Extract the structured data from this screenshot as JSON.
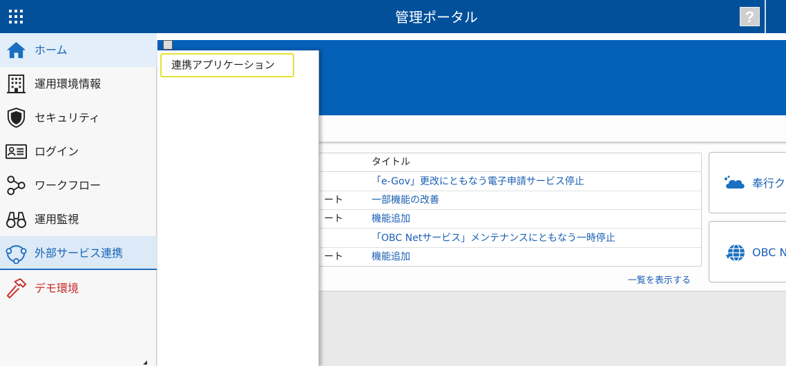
{
  "header": {
    "title": "管理ポータル",
    "apps_icon": "apps-grid-icon",
    "help_label": "?"
  },
  "sidebar": {
    "items": [
      {
        "label": "ホーム",
        "icon": "home-icon"
      },
      {
        "label": "運用環境情報",
        "icon": "building-icon"
      },
      {
        "label": "セキュリティ",
        "icon": "shield-icon"
      },
      {
        "label": "ログイン",
        "icon": "id-card-icon"
      },
      {
        "label": "ワークフロー",
        "icon": "workflow-icon"
      },
      {
        "label": "運用監視",
        "icon": "binoculars-icon"
      },
      {
        "label": "外部サービス連携",
        "icon": "link-circle-icon"
      },
      {
        "label": "デモ環境",
        "icon": "hammer-icon"
      }
    ]
  },
  "flyout": {
    "items": [
      {
        "label": "連携アプリケーション"
      }
    ]
  },
  "news": {
    "column_title": "タイトル",
    "rows": [
      {
        "category": "",
        "title": "「e-Gov」更改にともなう電子申請サービス停止"
      },
      {
        "category": "ート",
        "title": "一部機能の改善"
      },
      {
        "category": "ート",
        "title": "機能追加"
      },
      {
        "category": "",
        "title": "「OBC Netサービス」メンテナンスにともなう一時停止"
      },
      {
        "category": "ート",
        "title": "機能追加"
      }
    ],
    "show_all": "一覧を表示する"
  },
  "cards": [
    {
      "label": "奉行ク",
      "icon": "cloud-icon"
    },
    {
      "label": "OBC N",
      "icon": "globe-icon"
    }
  ],
  "colors": {
    "header": "#02509a",
    "hero": "#0560b7",
    "link": "#1a5fb4",
    "highlight_border": "#e4e232",
    "demo_red": "#c62828"
  }
}
